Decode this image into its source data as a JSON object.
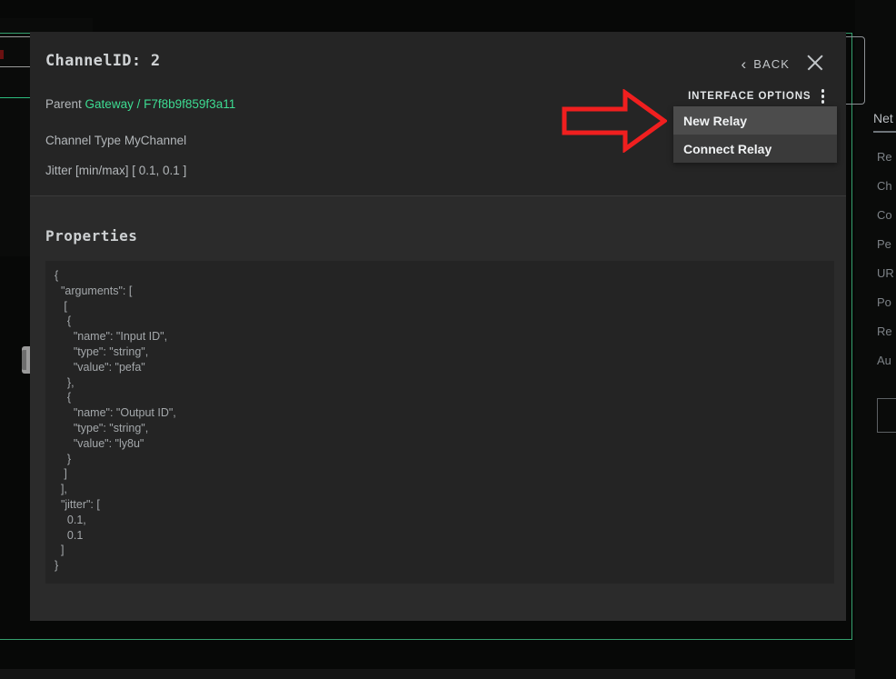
{
  "modal": {
    "title": "ChannelID: 2",
    "meta": {
      "parent_label": "Parent",
      "parent_value": "Gateway",
      "parent_sep": "/",
      "parent_id": "F7f8b9f859f3a11",
      "channel_type_line": "Channel Type MyChannel",
      "jitter_line": "Jitter [min/max] [ 0.1, 0.1 ]"
    },
    "back_label": "BACK",
    "back_icon": "chevron-left-icon",
    "close_icon": "close-icon",
    "interface_options_label": "INTERFACE OPTIONS",
    "kebab_icon": "kebab-menu-icon",
    "menu_items": [
      {
        "label": "New Relay",
        "highlighted": true
      },
      {
        "label": "Connect Relay",
        "highlighted": false
      }
    ],
    "properties": {
      "heading": "Properties",
      "json_text": "{\n  \"arguments\": [\n   [\n    {\n      \"name\": \"Input ID\",\n      \"type\": \"string\",\n      \"value\": \"pefa\"\n    },\n    {\n      \"name\": \"Output ID\",\n      \"type\": \"string\",\n      \"value\": \"ly8u\"\n    }\n   ]\n  ],\n  \"jitter\": [\n    0.1,\n    0.1\n  ]\n}"
    }
  },
  "annotation": {
    "type": "arrow-right",
    "color": "#f01f1f",
    "points_to": "New Relay"
  },
  "right_panel": {
    "title": "Net",
    "items": [
      "Re",
      "Ch",
      "Co",
      "Pe",
      "UR",
      "Po",
      "Re",
      "Au"
    ]
  },
  "colors": {
    "accent_green": "#3ddc92",
    "frame_green": "#35a06e",
    "annotation_red": "#f01f1f",
    "modal_bg": "#2b2b2b",
    "header_bg": "#252525",
    "code_bg": "#242424",
    "menu_bg": "#3a3a3a",
    "menu_highlight": "#4c4c4c"
  }
}
